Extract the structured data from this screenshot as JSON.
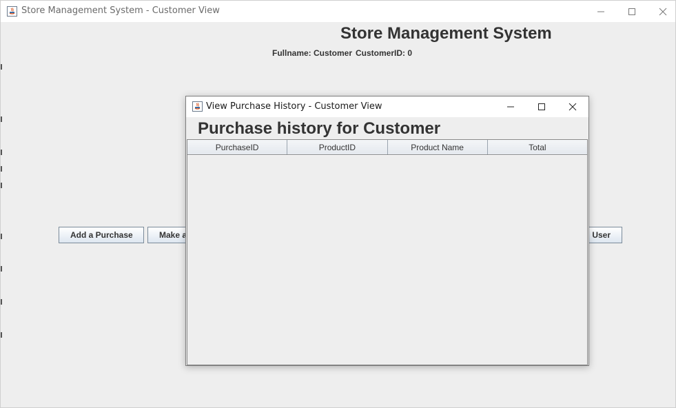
{
  "main_window": {
    "title": "Store Management System - Customer View",
    "heading": "Store Management System",
    "fullname_label": "Fullname: Customer",
    "customer_id_label": "CustomerID: 0",
    "buttons": {
      "add_purchase": "Add a Purchase",
      "make_partial": "Make a",
      "user_partial": "User"
    },
    "icons": {
      "app": "java-app-icon",
      "minimize": "minimize-icon",
      "maximize": "maximize-icon",
      "close": "close-icon"
    }
  },
  "dialog": {
    "title": "View Purchase History - Customer View",
    "heading": "Purchase history for Customer",
    "table": {
      "columns": [
        "PurchaseID",
        "ProductID",
        "Product Name",
        "Total"
      ],
      "rows": []
    }
  },
  "colors": {
    "window_bg": "#eeeeee",
    "titlebar_bg": "#ffffff",
    "text": "#333333"
  }
}
